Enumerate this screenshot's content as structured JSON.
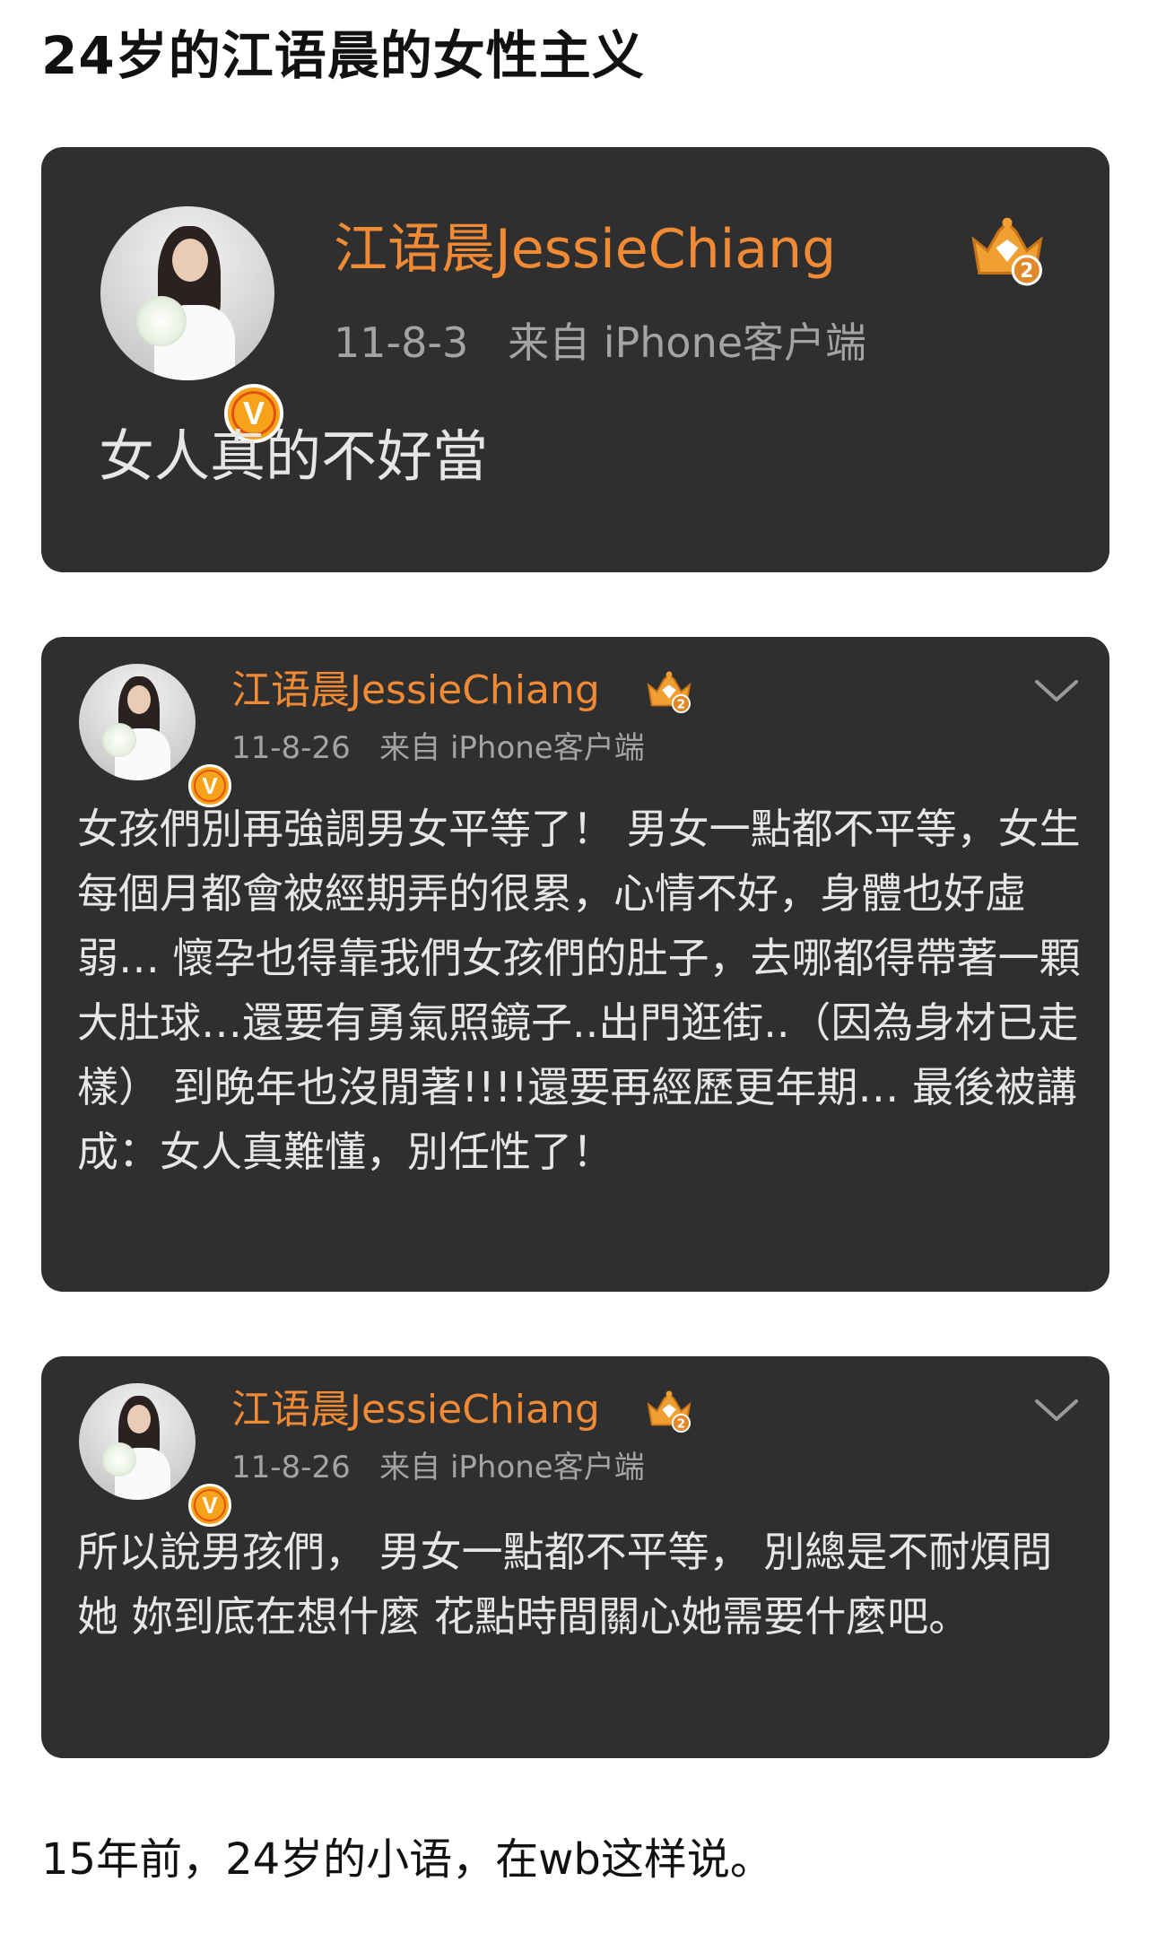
{
  "page": {
    "title": "24岁的江语晨的女性主义",
    "footer": "15年前，24岁的小语，在wb这样说。"
  },
  "colors": {
    "card_background": "#2f2f2f",
    "username": "#f08a35",
    "meta": "#a4a4a4",
    "post_text": "#e6e6e6",
    "verified_badge": "#f6a31b",
    "crown": "#f0a030"
  },
  "icons": {
    "avatar": "avatar-photo",
    "verified": "verified-v-badge-icon",
    "level": "crown-level-2-icon",
    "menu": "chevron-down-icon"
  },
  "posts": [
    {
      "username": "江语晨JessieChiang",
      "badge_letter": "V",
      "level": "2",
      "date": "11-8-3",
      "source": "来自 iPhone客户端",
      "text": "女人真的不好當"
    },
    {
      "username": "江语晨JessieChiang",
      "badge_letter": "V",
      "level": "2",
      "date": "11-8-26",
      "source": "来自 iPhone客户端",
      "text": "女孩們別再強調男女平等了！ 男女一點都不平等，女生每個月都會被經期弄的很累，心情不好，身體也好虛弱… 懷孕也得靠我們女孩們的肚子，去哪都得帶著一顆大肚球…還要有勇氣照鏡子..出門逛街..（因為身材已走樣） 到晚年也沒閒著!!!!還要再經歷更年期… 最後被講成：女人真難懂，別任性了！"
    },
    {
      "username": "江语晨JessieChiang",
      "badge_letter": "V",
      "level": "2",
      "date": "11-8-26",
      "source": "来自 iPhone客户端",
      "text": "所以說男孩們， 男女一點都不平等， 別總是不耐煩問她 妳到底在想什麼 花點時間關心她需要什麼吧。"
    }
  ]
}
